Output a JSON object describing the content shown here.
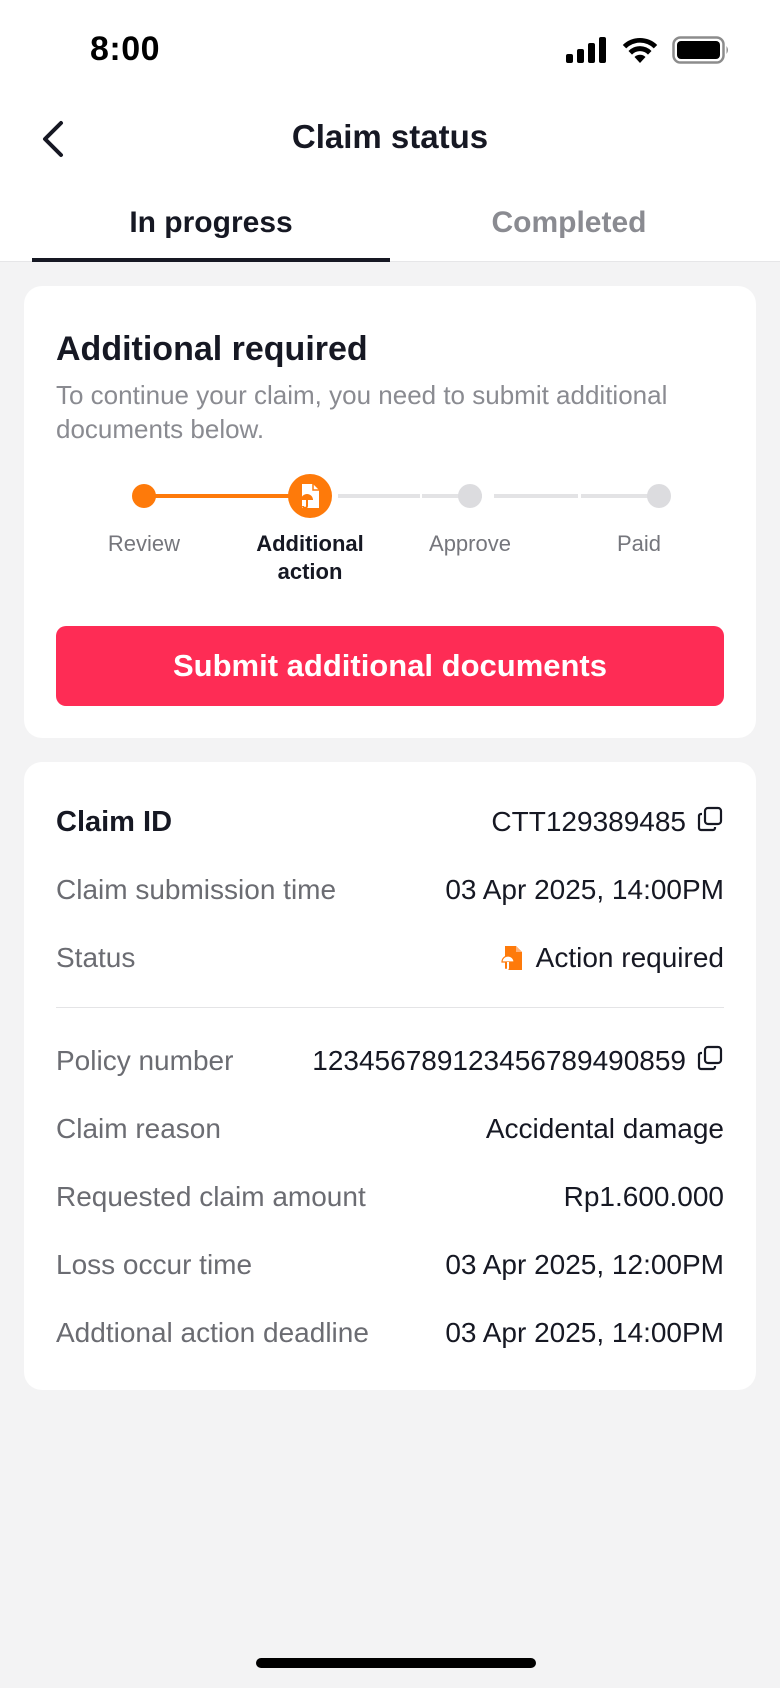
{
  "status_bar": {
    "time": "8:00"
  },
  "header": {
    "title": "Claim status",
    "back_icon": "chevron-left-icon"
  },
  "tabs": [
    {
      "label": "In progress",
      "active": true
    },
    {
      "label": "Completed",
      "active": false
    }
  ],
  "progress_card": {
    "title": "Additional required",
    "description": "To continue your claim, you need to submit additional documents below.",
    "steps": [
      {
        "label": "Review",
        "state": "done"
      },
      {
        "label": "Additional action",
        "state": "current"
      },
      {
        "label": "Approve",
        "state": "pending"
      },
      {
        "label": "Paid",
        "state": "pending"
      }
    ],
    "submit_button": "Submit additional documents",
    "accent_color": "#fe2c55",
    "step_color": "#fe7a0a"
  },
  "details": {
    "claim_id_label": "Claim ID",
    "claim_id_value": "CTT129389485",
    "submission_time_label": "Claim submission time",
    "submission_time_value": "03 Apr 2025, 14:00PM",
    "status_label": "Status",
    "status_value": "Action required",
    "policy_number_label": "Policy number",
    "policy_number_value": "12345678912345678949085​9",
    "claim_reason_label": "Claim reason",
    "claim_reason_value": "Accidental damage",
    "requested_amount_label": "Requested claim amount",
    "requested_amount_value": "Rp1.600.000",
    "loss_time_label": "Loss occur time",
    "loss_time_value": "03 Apr 2025, 12:00PM",
    "deadline_label": "Addtional action deadline",
    "deadline_value": "03 Apr 2025, 14:00PM"
  }
}
